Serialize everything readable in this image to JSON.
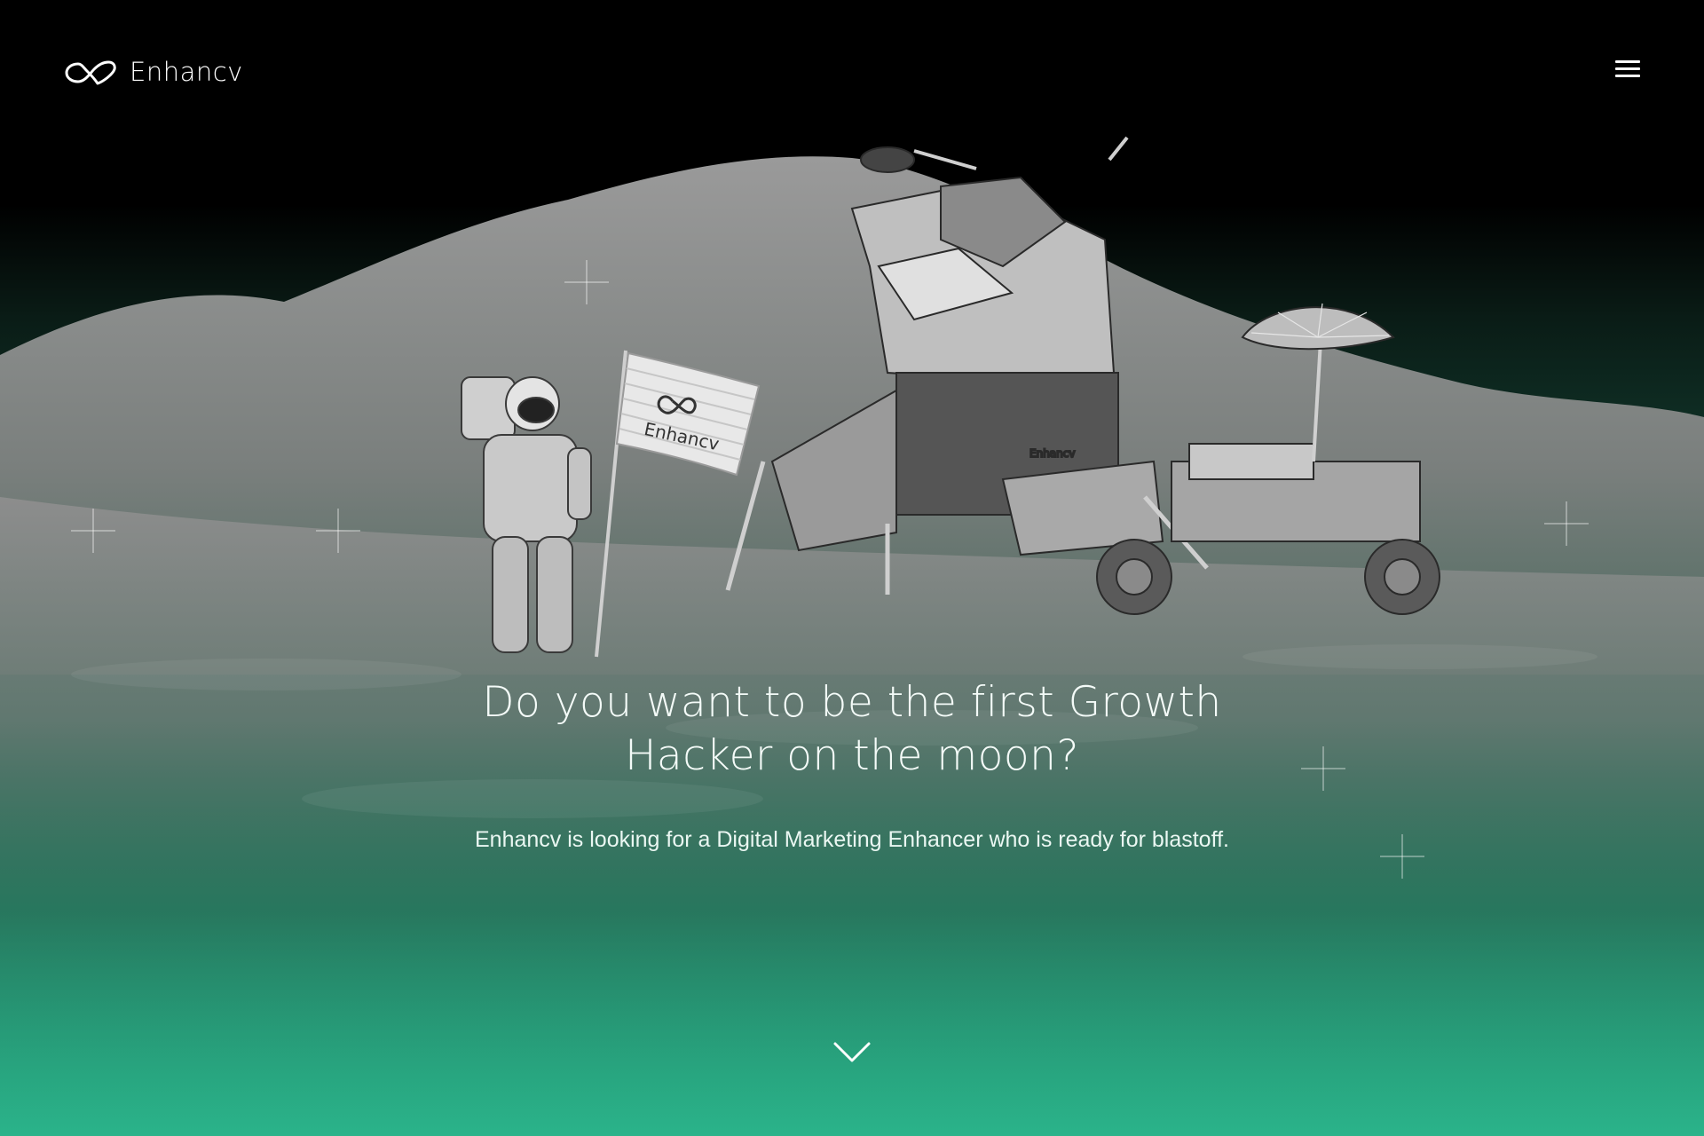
{
  "brand": {
    "name": "Enhancv",
    "logo_icon": "infinity-heart-logo",
    "flag_text": "Enhancv",
    "module_text": "Enhancv"
  },
  "nav": {
    "menu_icon": "hamburger-menu-icon"
  },
  "hero": {
    "headline": "Do you want to be the first Growth Hacker on the moon?",
    "subheadline": "Enhancv is looking for a Digital Marketing Enhancer who is ready for blastoff.",
    "scroll_icon": "chevron-down-icon"
  },
  "colors": {
    "sky": "#000000",
    "accent_green": "#2bb38a",
    "text": "#ffffff"
  }
}
